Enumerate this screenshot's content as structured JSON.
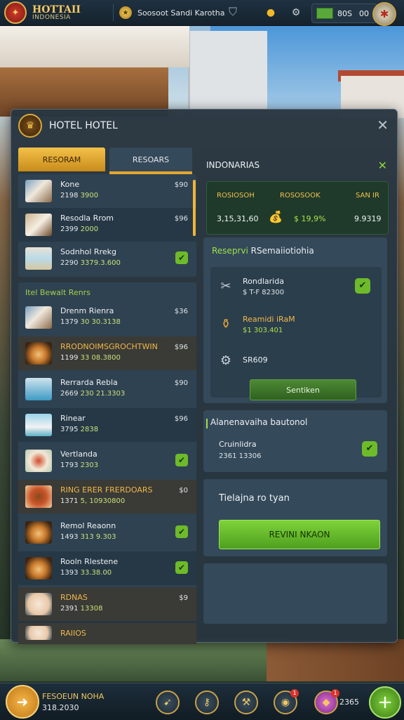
{
  "topbar": {
    "brand_line1": "HOTTAII",
    "brand_line2": "INDONESIA",
    "city": "Soosoot Sandi Karotha",
    "cash_left": "80S",
    "cash_right": "00"
  },
  "panel": {
    "title": "HOTEL HOTEL",
    "tabs": [
      "RESORAM",
      "RESOARS"
    ],
    "list_rooms": [
      {
        "name": "Kone",
        "sub_a": "2198",
        "sub_b": "3900",
        "price": "$90",
        "thumb": "t-room"
      },
      {
        "name": "Resodla Rrom",
        "sub_a": "2399",
        "sub_b": "2000",
        "price": "$96",
        "thumb": "t-bed"
      },
      {
        "name": "Sodnhol Rrekg",
        "sub_a": "2290",
        "sub_b": "3379.3.600",
        "price": "",
        "checked": true,
        "thumb": "t-beach"
      }
    ],
    "section_header": "Itel Bewalt Renrs",
    "list_dining": [
      {
        "name": "Drenm Rienra",
        "sub_a": "1379",
        "sub_b": "30 30.3138",
        "price": "$36",
        "thumb": "t-room"
      },
      {
        "name": "RRODNOIMSGROCHTWIN",
        "sub_a": "1199",
        "sub_b": "33 08.3800",
        "price": "$96",
        "gold": true,
        "thumb": "t-food"
      },
      {
        "name": "Rerrarda Rebla",
        "sub_a": "2669",
        "sub_b": "230 21.3303",
        "price": "$90",
        "thumb": "t-pool"
      },
      {
        "name": "Rinear",
        "sub_a": "3795",
        "sub_b": "2838",
        "price": "$96",
        "thumb": "t-person"
      },
      {
        "name": "Vertlanda",
        "sub_a": "1793",
        "sub_b": "2303",
        "price": "",
        "checked": true,
        "thumb": "t-plate"
      },
      {
        "name": "RING ERER FRERDOARS",
        "sub_a": "1371",
        "sub_b": "5, 10930800",
        "price": "$0",
        "gold": true,
        "thumb": "t-bowl"
      },
      {
        "name": "Remol Reaonn",
        "sub_a": "1493",
        "sub_b": "313 9.303",
        "price": "",
        "checked": true,
        "thumb": "t-food"
      },
      {
        "name": "Rooln Rlestene",
        "sub_a": "1393",
        "sub_b": "33.38.00",
        "price": "",
        "checked": true,
        "thumb": "t-food"
      },
      {
        "name": "RDNAS",
        "sub_a": "2391",
        "sub_b": "13308",
        "price": "$9",
        "gold": true,
        "thumb": "t-dump"
      },
      {
        "name": "RAIIOS",
        "sub_a": "",
        "sub_b": "",
        "price": "",
        "gold": true,
        "thumb": "t-dump"
      }
    ],
    "right_header": "INDONARIAS",
    "stats": {
      "label1": "ROSIOSOH",
      "label2": "ROSOSOOK",
      "label3": "SAN IR",
      "val1": "3,15,31,60",
      "val2": "$ 19,9%",
      "val3": "9.9319"
    },
    "reservation": {
      "title_a": "Reseprvi",
      "title_b": "RSemaiiotiohia",
      "items": [
        {
          "icon": "scissors-icon",
          "glyph": "✂",
          "name": "Rondlarida",
          "value": "$ T-F 82300",
          "checked": true
        },
        {
          "icon": "pot-icon",
          "glyph": "⚱",
          "name": "Reamidi iRaM",
          "value": "$1 303.401",
          "gold": true,
          "checked": false
        },
        {
          "icon": "gear-icon",
          "glyph": "⚙",
          "name": "SR609",
          "value": "",
          "checked": false
        }
      ],
      "button": "Sentiken"
    },
    "alternative": {
      "title": "Alanenavaiha bautonol",
      "name": "Cruinlidra",
      "value": "2361 13306"
    },
    "booking": {
      "title": "Tielajna ro tyan",
      "button": "REVINI NKAON"
    }
  },
  "bottombar": {
    "name": "FESOEUN NOHA",
    "value": "318.2030",
    "gems": "2365",
    "badge": "1"
  },
  "colors": {
    "accent_gold": "#f2c050",
    "accent_green": "#7fd23a",
    "panel_bg": "#283640"
  }
}
